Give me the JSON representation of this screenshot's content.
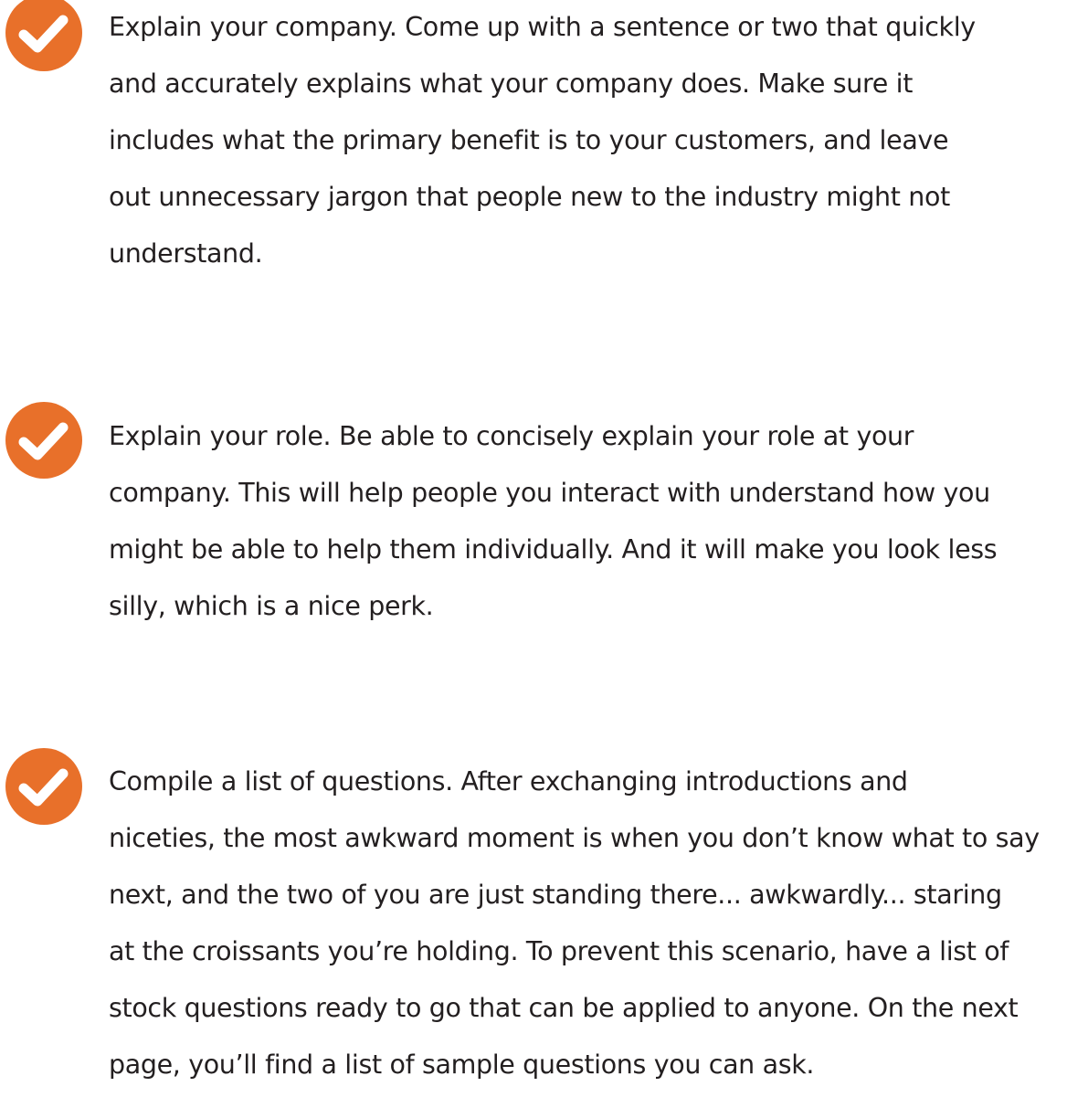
{
  "theme": {
    "accent": "#e8702a",
    "text": "#231f20",
    "background": "#ffffff"
  },
  "icons": {
    "bullet": "check-circle-icon"
  },
  "items": [
    {
      "lines": [
        "Explain your company. Come up with a sentence or two that quickly",
        "and accurately explains what your company does. Make sure it",
        "includes what the primary benefit is to your customers, and leave",
        "out unnecessary jargon that people new to the industry might not",
        "understand."
      ]
    },
    {
      "lines": [
        "Explain your role. Be able to concisely explain your role at your",
        "company. This will help people you interact with understand how you",
        "might be able to help them individually. And it will make you look less",
        "silly, which is a nice perk."
      ]
    },
    {
      "lines": [
        "Compile a list of questions. After exchanging introductions and",
        "niceties, the most awkward moment is when you don’t know what to say",
        "next, and the two of you are just standing there... awkwardly... staring",
        "at the croissants you’re holding. To prevent this scenario, have a list of",
        "stock questions ready to go that can be applied to anyone. On the next",
        "page, you’ll find a list of sample questions you can ask."
      ]
    }
  ]
}
